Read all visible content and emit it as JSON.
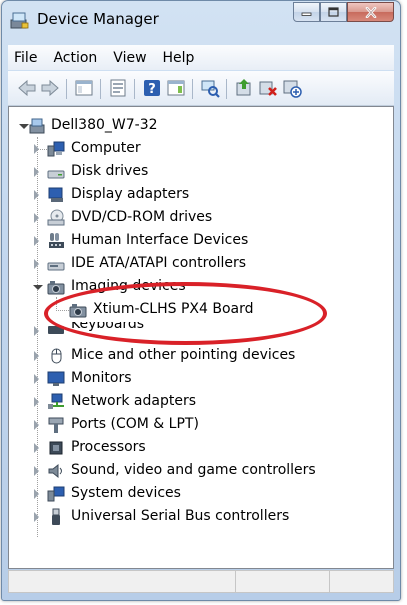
{
  "window": {
    "title": "Device Manager",
    "app_icon": "device-manager-icon",
    "caption_buttons": [
      "minimize-icon",
      "maximize-icon",
      "close-icon"
    ]
  },
  "menu": [
    "File",
    "Action",
    "View",
    "Help"
  ],
  "toolbar": {
    "buttons": [
      "back-arrow-icon",
      "forward-arrow-icon",
      "show-hide-console-tree-icon",
      "properties-icon",
      "help-icon",
      "show-action-pane-icon",
      "scan-hardware-changes-icon",
      "update-driver-icon",
      "uninstall-icon",
      "disable-device-icon"
    ]
  },
  "tree": {
    "root": "Dell380_W7-32",
    "categories": [
      {
        "label": "Computer",
        "icon": "computer-icon"
      },
      {
        "label": "Disk drives",
        "icon": "disk-drive-icon"
      },
      {
        "label": "Display adapters",
        "icon": "display-adapter-icon"
      },
      {
        "label": "DVD/CD-ROM drives",
        "icon": "dvd-drive-icon"
      },
      {
        "label": "Human Interface Devices",
        "icon": "hid-icon"
      },
      {
        "label": "IDE ATA/ATAPI controllers",
        "icon": "ide-controller-icon"
      },
      {
        "label": "Imaging devices",
        "icon": "imaging-device-icon",
        "expanded": true,
        "children": [
          {
            "label": "Xtium-CLHS PX4 Board",
            "icon": "camera-device-icon"
          }
        ]
      },
      {
        "label": "Keyboards",
        "icon": "keyboard-icon"
      },
      {
        "label": "Mice and other pointing devices",
        "icon": "mouse-icon"
      },
      {
        "label": "Monitors",
        "icon": "monitor-icon"
      },
      {
        "label": "Network adapters",
        "icon": "network-adapter-icon"
      },
      {
        "label": "Ports (COM & LPT)",
        "icon": "port-icon"
      },
      {
        "label": "Processors",
        "icon": "processor-icon"
      },
      {
        "label": "Sound, video and game controllers",
        "icon": "sound-icon"
      },
      {
        "label": "System devices",
        "icon": "system-device-icon"
      },
      {
        "label": "Universal Serial Bus controllers",
        "icon": "usb-icon"
      }
    ]
  },
  "colors": {
    "highlight_oval": "#d92128",
    "title_bar": "#c2d6ee"
  }
}
